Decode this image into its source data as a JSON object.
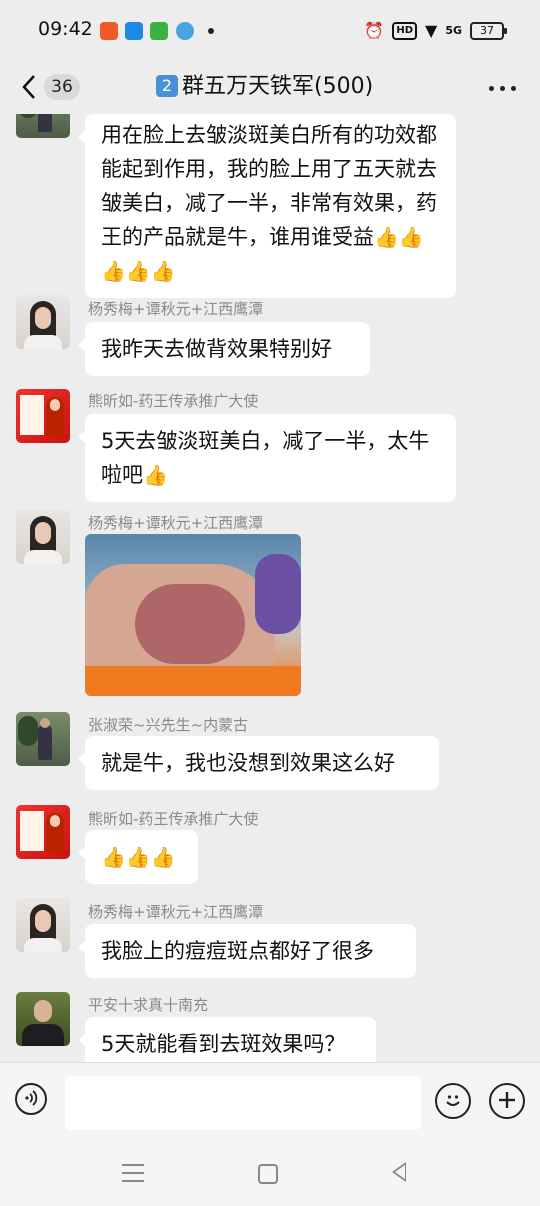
{
  "status": {
    "time": "09:42",
    "hd": "HD",
    "network": "5G",
    "battery": "37",
    "colors": {
      "app1": "#f05a28",
      "app2": "#1e88e5",
      "app3": "#3cb043",
      "app4": "#4aa3df"
    }
  },
  "header": {
    "back_label": "<",
    "unread_count": "36",
    "group_number": "2",
    "title": "群五万天铁军(500)"
  },
  "messages": [
    {
      "sender": "",
      "text": "用在脸上去皱淡斑美白所有的功效都能起到作用，我的脸上用了五天就去皱美白，减了一半，非常有效果，药王的产品就是牛，谁用谁受益"
    },
    {
      "sender": "杨秀梅+谭秋元+江西鹰潭",
      "text": "我昨天去做背效果特别好"
    },
    {
      "sender": "熊昕如-药王传承推广大使",
      "text": "5天去皱淡斑美白，减了一半，太牛啦吧"
    },
    {
      "sender": "杨秀梅+谭秋元+江西鹰潭",
      "text": ""
    },
    {
      "sender": "张淑荣~兴先生~内蒙古",
      "text": "就是牛，我也没想到效果这么好"
    },
    {
      "sender": "熊昕如-药王传承推广大使",
      "text": ""
    },
    {
      "sender": "杨秀梅+谭秋元+江西鹰潭",
      "text": "我脸上的痘痘斑点都好了很多"
    },
    {
      "sender": "平安十求真十南充",
      "text": "5天就能看到去斑效果吗？"
    }
  ],
  "thumbs": {
    "icon": "👍"
  },
  "input": {
    "placeholder": ""
  }
}
